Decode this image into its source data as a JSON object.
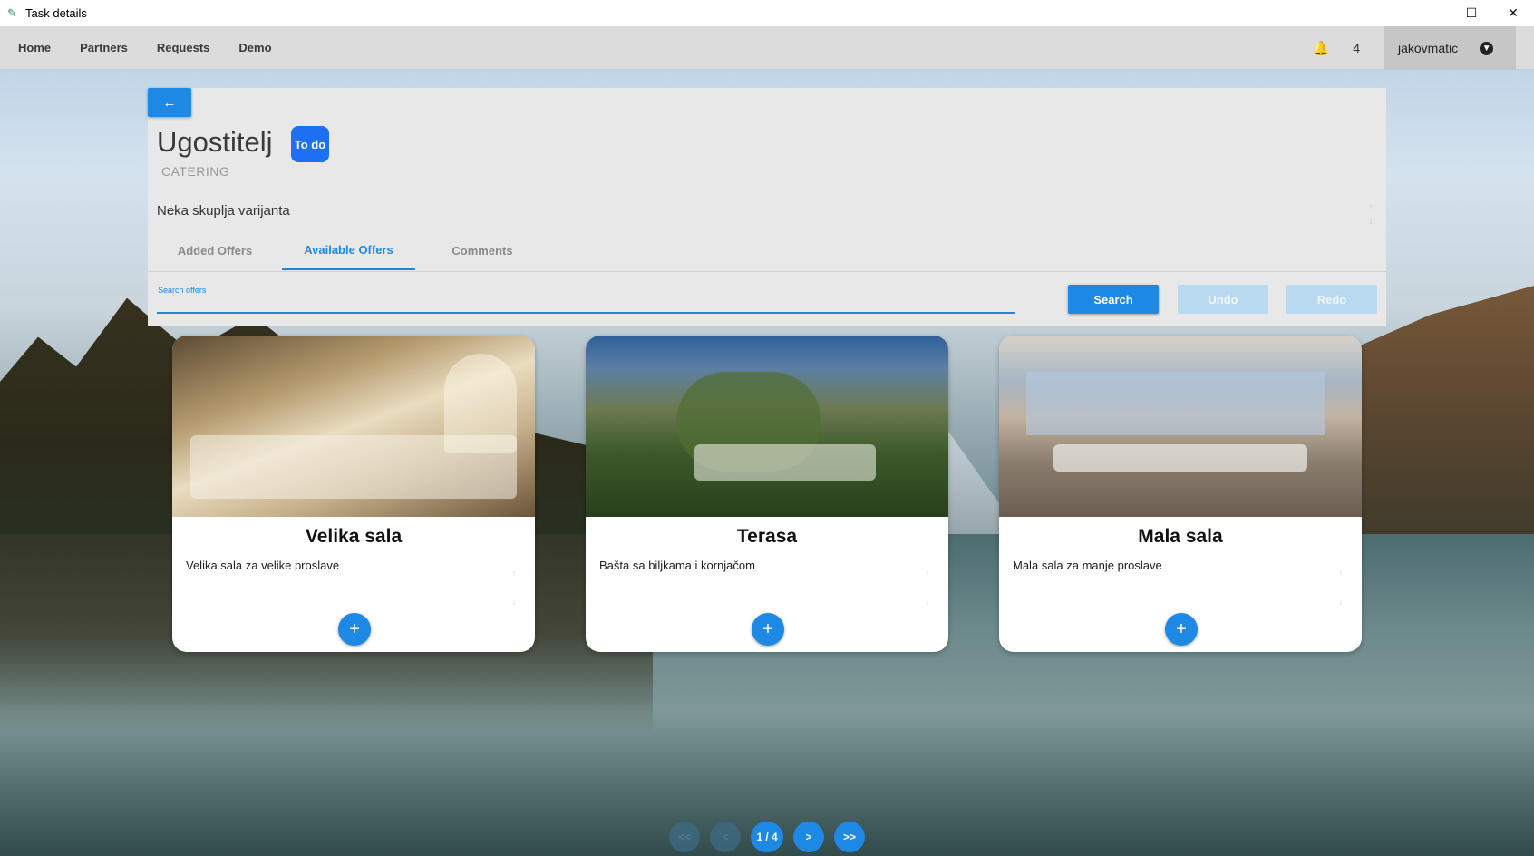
{
  "window": {
    "title": "Task details",
    "minimize_icon": "minimize-icon",
    "maximize_icon": "maximize-icon",
    "close_icon": "close-icon"
  },
  "nav": {
    "items": [
      {
        "label": "Home"
      },
      {
        "label": "Partners"
      },
      {
        "label": "Requests"
      },
      {
        "label": "Demo"
      }
    ],
    "notifications_count": "4",
    "username": "jakovmatic"
  },
  "task": {
    "title": "Ugostitelj",
    "status": "To do",
    "category": "CATERING",
    "description": "Neka skuplja varijanta"
  },
  "tabs": [
    {
      "label": "Added Offers",
      "active": false
    },
    {
      "label": "Available Offers",
      "active": true
    },
    {
      "label": "Comments",
      "active": false
    }
  ],
  "search": {
    "label": "Search offers",
    "value": "",
    "search_label": "Search",
    "undo_label": "Undo",
    "redo_label": "Redo"
  },
  "offers": [
    {
      "name": "Velika sala",
      "description": "Velika sala za velike proslave",
      "add_label": "+"
    },
    {
      "name": "Terasa",
      "description": "Bašta sa biljkama i kornjačom",
      "add_label": "+"
    },
    {
      "name": "Mala sala",
      "description": "Mala sala za manje proslave",
      "add_label": "+"
    }
  ],
  "pagination": {
    "first_label": "<<",
    "prev_label": "<",
    "current_label": "1 / 4",
    "next_label": ">",
    "last_label": ">>"
  },
  "colors": {
    "accent": "#1e88e5",
    "badge": "#1e6ff1",
    "navbar": "#dcdcdc"
  }
}
